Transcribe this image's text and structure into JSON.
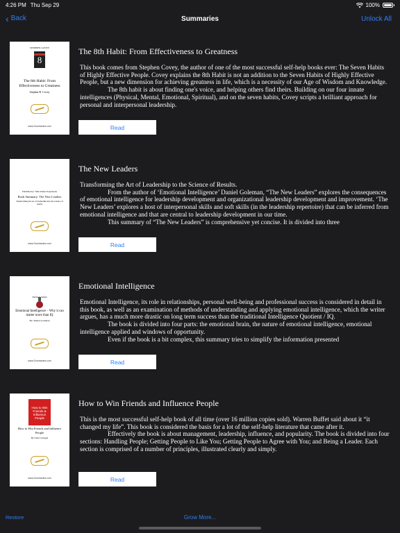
{
  "status": {
    "time": "4:26 PM",
    "date": "Thu Sep 29",
    "battery": "100%"
  },
  "nav": {
    "back": "Back",
    "title": "Summaries",
    "unlock": "Unlock All"
  },
  "books": [
    {
      "title": "The 8th Habit: From Effectiveness to Greatness",
      "paragraphs": [
        "This book comes from Stephen Covey, the author of one of the most successful self-help books ever: The Seven Habits of Highly Effective People. Covey explains the 8th Habit is not an addition to the Seven Habits of Highly Effective People, but a new dimension for achieving greatness in life, which is a necessity of our Age of Wisdom and Knowledge.",
        "The 8th habit is about finding one's voice, and helping others find theirs. Building on our four innate intelligences (Physical, Mental, Emotional, Spiritual), and on the seven habits, Covey scripts a brilliant approach for personal and interpersonal leadership."
      ],
      "read": "Read",
      "cover": {
        "brand": "STEPHEN COVEY",
        "title": "The 8th Habit: From Effectiveness to Greatness",
        "author": "Stephen R. Covey",
        "publisher": "www.Summaries.com"
      }
    },
    {
      "title": "The New Leaders",
      "paragraphs": [
        "Transforming the Art of Leadership to the Science of Results.",
        "From the author of ‘Emotional Intelligence’ Daniel Goleman, “The New Leaders” explores the consequences of emotional intelligence for leadership development and organizational leadership development and improvement. ‘The New Leaders’ explores a host of interpersonal skills and soft skills (in the leadership repertoire) that can be inferred from emotional intelligence and that are central to leadership development in our time.",
        "This summary of “The New Leaders” is comprehensive yet concise. It is divided into three"
      ],
      "read": "Read",
      "cover": {
        "brand": "Published by: Time Warner Paperbacks",
        "title": "Book Summary: The New Leaders",
        "author": "Transforming the art of leadership into the science of results",
        "publisher": "www.Summaries.com"
      }
    },
    {
      "title": "Emotional Intelligence",
      "paragraphs": [
        "Emotional Intelligence, its role in relationships, personal well-being and professional success is considered in detail in this book, as well as an examination of methods of understanding and applying emotional intelligence, which the writer argues, has a much more drastic on long term success than the traditional Intelligence Quotient / IQ.",
        "The book is divided into four parts: the emotional brain, the nature of emotional intelligence, emotional intelligence applied and windows of opportunity.",
        "Even if the book is a bit complex, this summary tries to simplify the information presented"
      ],
      "read": "Read",
      "cover": {
        "brand": "Daniel Goleman",
        "title": "Emotional Intelligence – Why it can matter more than IQ",
        "author": "By: Daniel Goleman",
        "publisher": "www.Summaries.com"
      }
    },
    {
      "title": "How to Win Friends and Influence People",
      "paragraphs": [
        "This is the most successful self-help book of all time (over 16 million copies sold). Warren Buffet said about it “it changed my life”. This book is considered the basis for a lot of the self-help literature that came after it.",
        "Effectively the book is about management, leadership, influence, and popularity. The book is divided into four sections: Handling People; Getting People to Like You; Getting People to Agree with You; and Being a Leader. Each section is comprised of a number of principles, illustrated clearly and simply."
      ],
      "read": "Read",
      "cover": {
        "brand": "How to Win Friends & Influence People",
        "title": "How to Win Friends and Influence People",
        "author": "By: Dale Carnegie",
        "publisher": "www.Summaries.com"
      }
    }
  ],
  "footer": {
    "restore": "Restore",
    "grow": "Grow More..."
  },
  "colors": {
    "accent": "#2f7ff7",
    "background": "#1c1c1e"
  }
}
